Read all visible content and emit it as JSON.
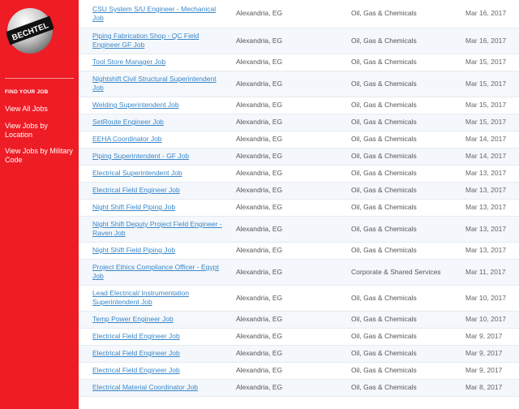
{
  "brand": {
    "logo_text": "BECHTEL",
    "primary_color": "#ee1c25",
    "link_color": "#3a87c8"
  },
  "sidebar": {
    "heading": "FIND YOUR JOB",
    "links": [
      {
        "label": "View All Jobs"
      },
      {
        "label": "View Jobs by Location"
      },
      {
        "label": "View Jobs by Military Code"
      }
    ]
  },
  "jobs": [
    {
      "title": "CSU System S/U Engineer - Mechanical Job",
      "location": "Alexandria, EG",
      "industry": "Oil, Gas & Chemicals",
      "date": "Mar 16, 2017"
    },
    {
      "title": "Piping Fabrication Shop - QC Field Engineer GF Job",
      "location": "Alexandria, EG",
      "industry": "Oil, Gas & Chemicals",
      "date": "Mar 16, 2017"
    },
    {
      "title": "Tool Store Manager Job",
      "location": "Alexandria, EG",
      "industry": "Oil, Gas & Chemicals",
      "date": "Mar 15, 2017"
    },
    {
      "title": "Nightshift Civil Structural Superintendent Job",
      "location": "Alexandria, EG",
      "industry": "Oil, Gas & Chemicals",
      "date": "Mar 15, 2017"
    },
    {
      "title": "Welding Superintendent Job",
      "location": "Alexandria, EG",
      "industry": "Oil, Gas & Chemicals",
      "date": "Mar 15, 2017"
    },
    {
      "title": "SetRoute Engineer Job",
      "location": "Alexandria, EG",
      "industry": "Oil, Gas & Chemicals",
      "date": "Mar 15, 2017"
    },
    {
      "title": "EEHA Coordinator Job",
      "location": "Alexandria, EG",
      "industry": "Oil, Gas & Chemicals",
      "date": "Mar 14, 2017"
    },
    {
      "title": "Piping Superintendent - GF Job",
      "location": "Alexandria, EG",
      "industry": "Oil, Gas & Chemicals",
      "date": "Mar 14, 2017"
    },
    {
      "title": "Electrical Superintendent Job",
      "location": "Alexandria, EG",
      "industry": "Oil, Gas & Chemicals",
      "date": "Mar 13, 2017"
    },
    {
      "title": "Electrical Field Engineer Job",
      "location": "Alexandria, EG",
      "industry": "Oil, Gas & Chemicals",
      "date": "Mar 13, 2017"
    },
    {
      "title": "Night Shift Field Piping Job",
      "location": "Alexandria, EG",
      "industry": "Oil, Gas & Chemicals",
      "date": "Mar 13, 2017"
    },
    {
      "title": "Night Shift Deputy Project Field Engineer -Raven Job",
      "location": "Alexandria, EG",
      "industry": "Oil, Gas & Chemicals",
      "date": "Mar 13, 2017"
    },
    {
      "title": "Night Shift Field Piping Job",
      "location": "Alexandria, EG",
      "industry": "Oil, Gas & Chemicals",
      "date": "Mar 13, 2017"
    },
    {
      "title": "Project Ethics Compliance Officer - Egypt Job",
      "location": "Alexandria, EG",
      "industry": "Corporate & Shared Services",
      "date": "Mar 11, 2017"
    },
    {
      "title": "Lead Electrical/ Instrumentation Superintendent Job",
      "location": "Alexandria, EG",
      "industry": "Oil, Gas & Chemicals",
      "date": "Mar 10, 2017"
    },
    {
      "title": "Temp Power Engineer Job",
      "location": "Alexandria, EG",
      "industry": "Oil, Gas & Chemicals",
      "date": "Mar 10, 2017"
    },
    {
      "title": "Electrical Field Engineer Job",
      "location": "Alexandria, EG",
      "industry": "Oil, Gas & Chemicals",
      "date": "Mar 9, 2017"
    },
    {
      "title": "Electrical Field Engineer Job",
      "location": "Alexandria, EG",
      "industry": "Oil, Gas & Chemicals",
      "date": "Mar 9, 2017"
    },
    {
      "title": "Electrical Field Engineer Job",
      "location": "Alexandria, EG",
      "industry": "Oil, Gas & Chemicals",
      "date": "Mar 9, 2017"
    },
    {
      "title": "Electrical Material Coordinator Job",
      "location": "Alexandria, EG",
      "industry": "Oil, Gas & Chemicals",
      "date": "Mar 8, 2017"
    }
  ]
}
